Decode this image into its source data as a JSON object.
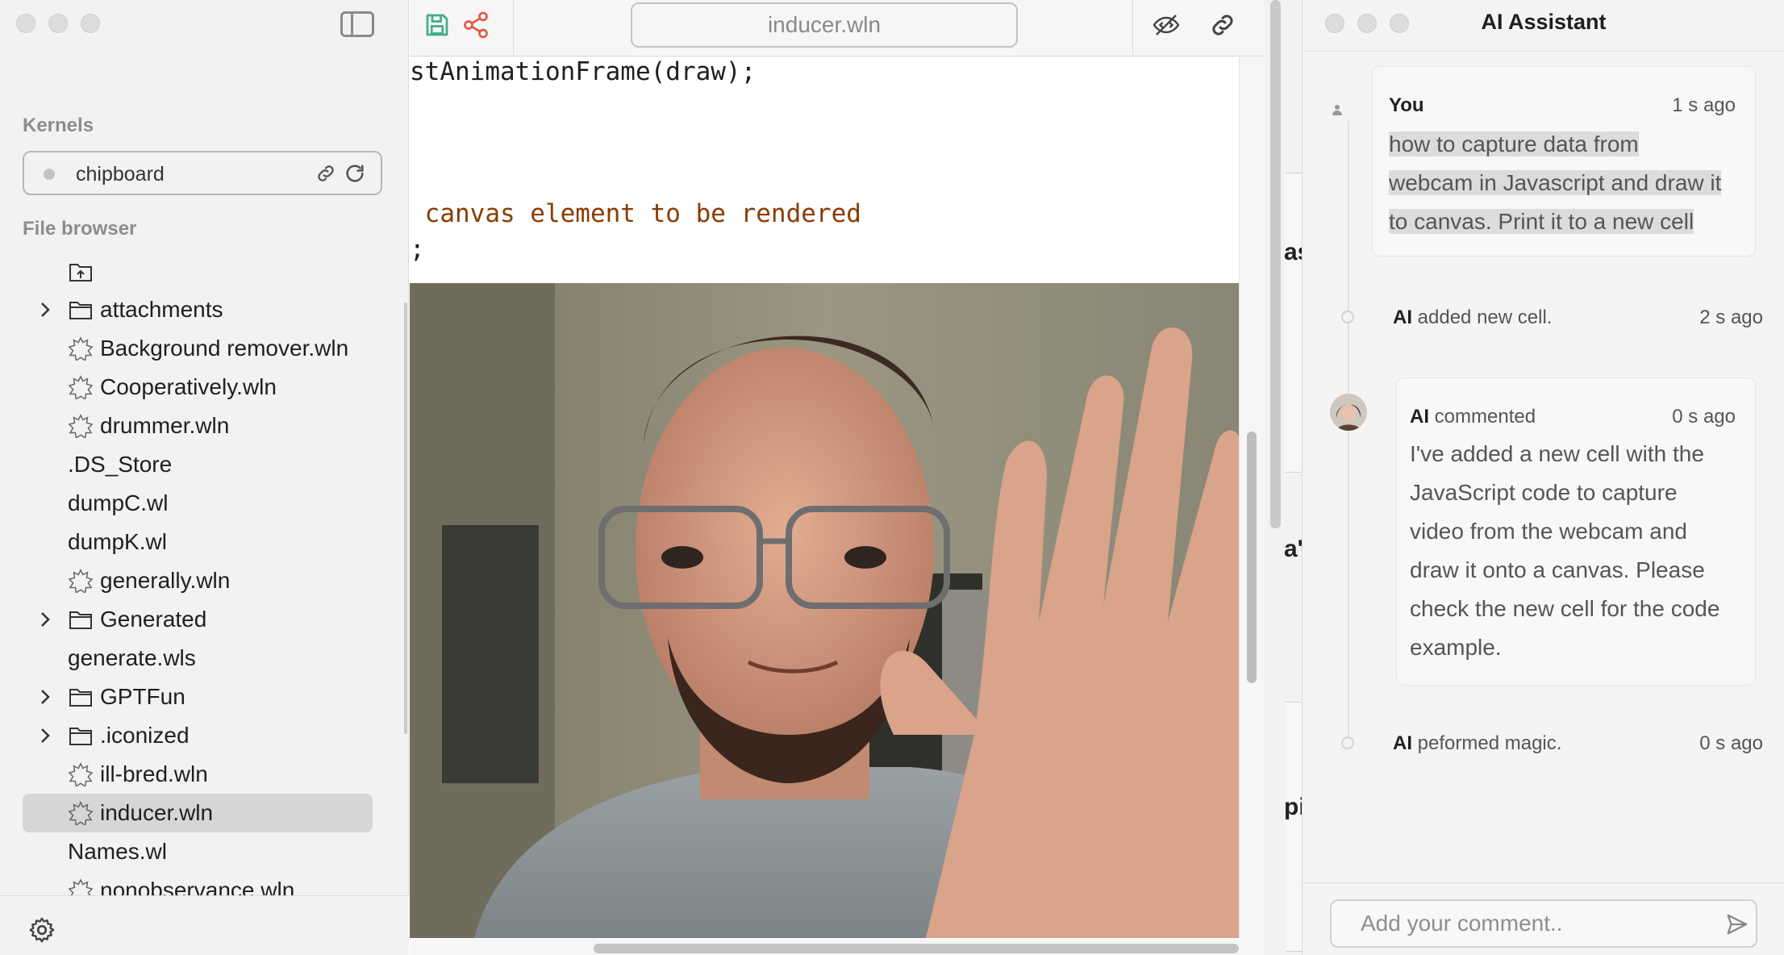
{
  "sidebar": {
    "kernels_label": "Kernels",
    "kernel_name": "chipboard",
    "file_browser_label": "File browser",
    "files": [
      {
        "name": "",
        "kind": "upload"
      },
      {
        "name": "attachments",
        "kind": "folder"
      },
      {
        "name": "Background remover.wln",
        "kind": "notebook"
      },
      {
        "name": "Cooperatively.wln",
        "kind": "notebook"
      },
      {
        "name": "drummer.wln",
        "kind": "notebook"
      },
      {
        "name": ".DS_Store",
        "kind": "file"
      },
      {
        "name": "dumpC.wl",
        "kind": "file"
      },
      {
        "name": "dumpK.wl",
        "kind": "file"
      },
      {
        "name": "generally.wln",
        "kind": "notebook"
      },
      {
        "name": "Generated",
        "kind": "folder"
      },
      {
        "name": "generate.wls",
        "kind": "file"
      },
      {
        "name": "GPTFun",
        "kind": "folder"
      },
      {
        "name": ".iconized",
        "kind": "folder"
      },
      {
        "name": "ill-bred.wln",
        "kind": "notebook"
      },
      {
        "name": "inducer.wln",
        "kind": "notebook",
        "selected": true
      },
      {
        "name": "Names.wl",
        "kind": "file"
      },
      {
        "name": "nonobservance.wln",
        "kind": "notebook"
      }
    ]
  },
  "editor": {
    "title": "inducer.wln",
    "code_line_1": "stAnimationFrame(draw);",
    "code_line_2": " canvas element to be rendered",
    "code_line_3": ";"
  },
  "strip": {
    "fragments": [
      "as",
      "a'",
      "pi"
    ]
  },
  "assistant": {
    "title": "AI Assistant",
    "user_card": {
      "user": "You",
      "time": "1 s ago",
      "lines": [
        "how to capture data from",
        "webcam in Javascript and draw it",
        "to canvas. Print it to a new cell"
      ]
    },
    "event_1": {
      "actor": "AI",
      "text": " added new cell.",
      "time": "2 s ago"
    },
    "ai_card": {
      "actor": "AI",
      "verb": " commented",
      "time": "0 s ago",
      "lines": [
        "I've added a new cell with the",
        "JavaScript code to capture",
        "video from the webcam and",
        "draw it onto a canvas. Please",
        "check the new cell for the code",
        "example."
      ]
    },
    "event_2": {
      "actor": "AI",
      "text": " peformed magic.",
      "time": "0 s ago"
    },
    "comment_placeholder": "Add your comment.."
  },
  "colors": {
    "save_icon": "#3fae8b",
    "share_icon": "#e0594a",
    "string_code": "#8a3c00"
  }
}
